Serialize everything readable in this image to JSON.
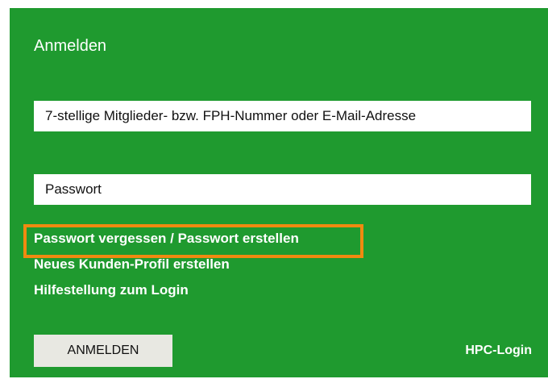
{
  "login": {
    "title": "Anmelden",
    "username_placeholder": "7-stellige Mitglieder- bzw. FPH-Nummer oder E-Mail-Adresse",
    "password_placeholder": "Passwort",
    "links": [
      "Passwort vergessen / Passwort erstellen",
      "Neues Kunden-Profil erstellen",
      "Hilfestellung zum Login"
    ],
    "submit_label": "ANMELDEN",
    "hpc_label": "HPC-Login"
  },
  "colors": {
    "panel_background": "#1f9a2f",
    "highlight_border": "#f08a10",
    "button_background": "#e8e8e2"
  }
}
